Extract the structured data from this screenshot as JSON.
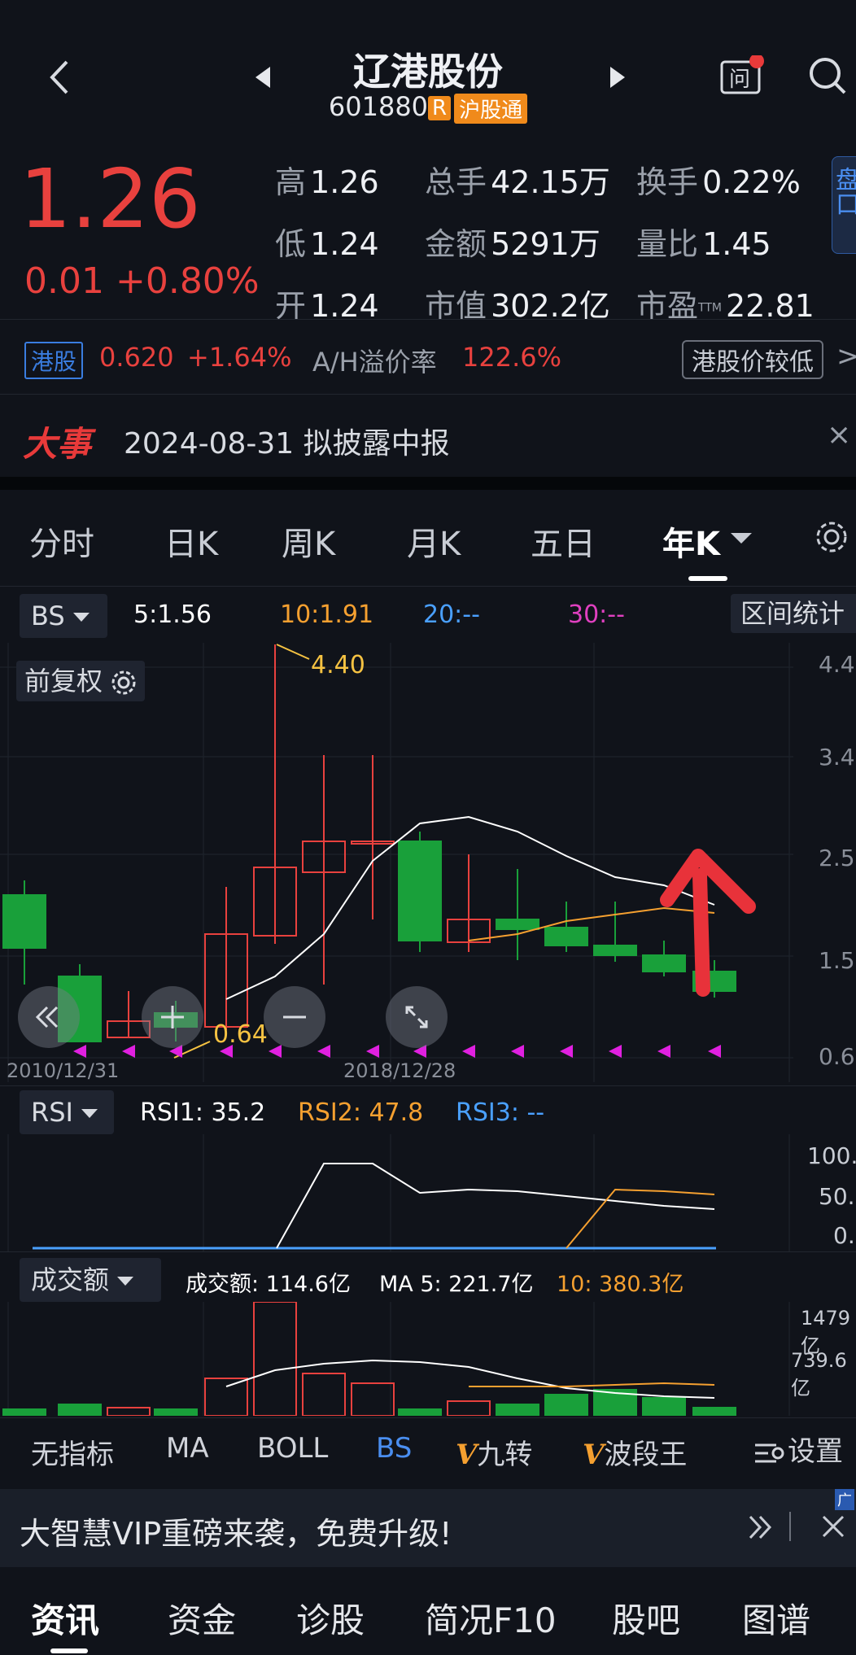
{
  "header": {
    "title": "辽港股份",
    "code": "601880",
    "badge_r": "R",
    "badge_hk": "沪股通"
  },
  "quote": {
    "price": "1.26",
    "change": "0.01",
    "change_pct": "+0.80%",
    "high_label": "高",
    "high": "1.26",
    "low_label": "低",
    "low": "1.24",
    "open_label": "开",
    "open": "1.24",
    "volume_label": "总手",
    "volume": "42.15万",
    "amount_label": "金额",
    "amount": "5291万",
    "mktcap_label": "市值",
    "mktcap": "302.2亿",
    "turnover_label": "换手",
    "turnover": "0.22%",
    "vol_ratio_label": "量比",
    "vol_ratio": "1.45",
    "pe_label": "市盈",
    "pe_sup": "TTM",
    "pe": "22.81",
    "side_tab": "盘口"
  },
  "hk": {
    "tag": "港股",
    "price": "0.620",
    "pct": "+1.64%",
    "premium_label": "A/H溢价率",
    "premium": "122.6%",
    "compare_btn": "港股价较低",
    "arrow": ">"
  },
  "news": {
    "tag": "大事",
    "text": "2024-08-31 拟披露中报",
    "close": "×"
  },
  "tabs": {
    "items": [
      "分时",
      "日K",
      "周K",
      "月K",
      "五日",
      "年K"
    ],
    "active": "年K"
  },
  "ma_bar": {
    "bs_label": "BS",
    "ma5": "5:1.56",
    "ma10": "10:1.91",
    "ma20": "20:--",
    "ma30": "30:--",
    "range_btn": "区间统计"
  },
  "kline": {
    "adj_label": "前复权",
    "high_mark": "4.40",
    "low_mark": "0.64",
    "y_ticks": [
      "4.4",
      "3.4",
      "2.5",
      "1.5",
      "0.6"
    ],
    "x_labels": [
      "2010/12/31",
      "2018/12/28"
    ]
  },
  "rsi": {
    "label": "RSI",
    "rsi1": "RSI1: 35.2",
    "rsi2": "RSI2: 47.8",
    "rsi3": "RSI3: --",
    "y_ticks": [
      "100.",
      "50.",
      "0."
    ]
  },
  "vol": {
    "label": "成交额",
    "amount": "成交额: 114.6亿",
    "ma5": "MA 5: 221.7亿",
    "ma10": "10: 380.3亿",
    "y_ticks": [
      "1479亿",
      "739.6亿"
    ]
  },
  "indicators": {
    "items": [
      "无指标",
      "MA",
      "BOLL",
      "BS",
      "九转",
      "波段王"
    ],
    "settings": "设置"
  },
  "ad": {
    "text": "大智慧VIP重磅来袭，免费升级!",
    "tag": "广"
  },
  "bottom_nav": {
    "items": [
      "资讯",
      "资金",
      "诊股",
      "简况F10",
      "股吧",
      "图谱"
    ],
    "active": "资讯"
  },
  "colors": {
    "up": "#e8413e",
    "down": "#19a03a",
    "ma5": "#ffffff",
    "ma10": "#f5a030",
    "ma20": "#4aa0ff",
    "ma30": "#e040c0",
    "bg": "#10131a"
  }
}
